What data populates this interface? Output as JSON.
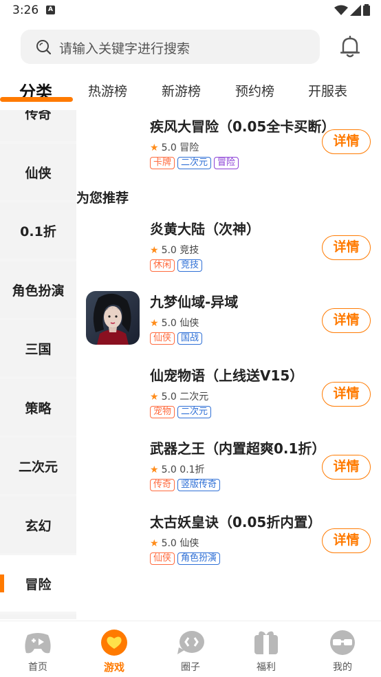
{
  "status_bar": {
    "time": "3:26",
    "notification_glyph": "A"
  },
  "search": {
    "placeholder": "请输入关键字进行搜索"
  },
  "tabs": [
    {
      "label": "分类",
      "active": true
    },
    {
      "label": "热游榜"
    },
    {
      "label": "新游榜"
    },
    {
      "label": "预约榜"
    },
    {
      "label": "开服表"
    }
  ],
  "sidebar": {
    "items": [
      {
        "label": "传奇"
      },
      {
        "label": "仙侠"
      },
      {
        "label": "0.1折"
      },
      {
        "label": "角色扮演"
      },
      {
        "label": "三国"
      },
      {
        "label": "策略"
      },
      {
        "label": "二次元"
      },
      {
        "label": "玄幻"
      },
      {
        "label": "冒险",
        "active": true
      }
    ]
  },
  "content": {
    "recommend_title": "为您推荐",
    "detail_label": "详情",
    "games": [
      {
        "name": "疾风大冒险（0.05全卡买断）",
        "rating": "5.0",
        "genre": "冒险",
        "tags": [
          {
            "text": "卡牌",
            "color": "red"
          },
          {
            "text": "二次元",
            "color": "blue"
          },
          {
            "text": "冒险",
            "color": "purple"
          }
        ]
      },
      {
        "name": "炎黄大陆（次神）",
        "rating": "5.0",
        "genre": "竞技",
        "tags": [
          {
            "text": "休闲",
            "color": "red"
          },
          {
            "text": "竞技",
            "color": "blue"
          }
        ]
      },
      {
        "name": "九梦仙域-异域",
        "rating": "5.0",
        "genre": "仙侠",
        "tags": [
          {
            "text": "仙侠",
            "color": "red"
          },
          {
            "text": "国战",
            "color": "blue"
          }
        ]
      },
      {
        "name": "仙宠物语（上线送V15）",
        "rating": "5.0",
        "genre": "二次元",
        "tags": [
          {
            "text": "宠物",
            "color": "red"
          },
          {
            "text": "二次元",
            "color": "blue"
          }
        ]
      },
      {
        "name": "武器之王（内置超爽0.1折）",
        "rating": "5.0",
        "genre": "0.1折",
        "tags": [
          {
            "text": "传奇",
            "color": "red"
          },
          {
            "text": "竖版传奇",
            "color": "blue"
          }
        ]
      },
      {
        "name": "太古妖皇诀（0.05折内置）",
        "rating": "5.0",
        "genre": "仙侠",
        "tags": [
          {
            "text": "仙侠",
            "color": "red"
          },
          {
            "text": "角色扮演",
            "color": "blue"
          }
        ]
      }
    ]
  },
  "bottom_nav": [
    {
      "label": "首页",
      "icon": "gamepad-icon"
    },
    {
      "label": "游戏",
      "icon": "game-heart-icon",
      "active": true
    },
    {
      "label": "圈子",
      "icon": "chat-bubble-icon"
    },
    {
      "label": "福利",
      "icon": "gift-icon"
    },
    {
      "label": "我的",
      "icon": "profile-glasses-icon"
    }
  ],
  "colors": {
    "accent": "#ff7a00",
    "tag_red": "#ff6a3d",
    "tag_blue": "#2e6fd6",
    "tag_purple": "#8b3fd6"
  }
}
